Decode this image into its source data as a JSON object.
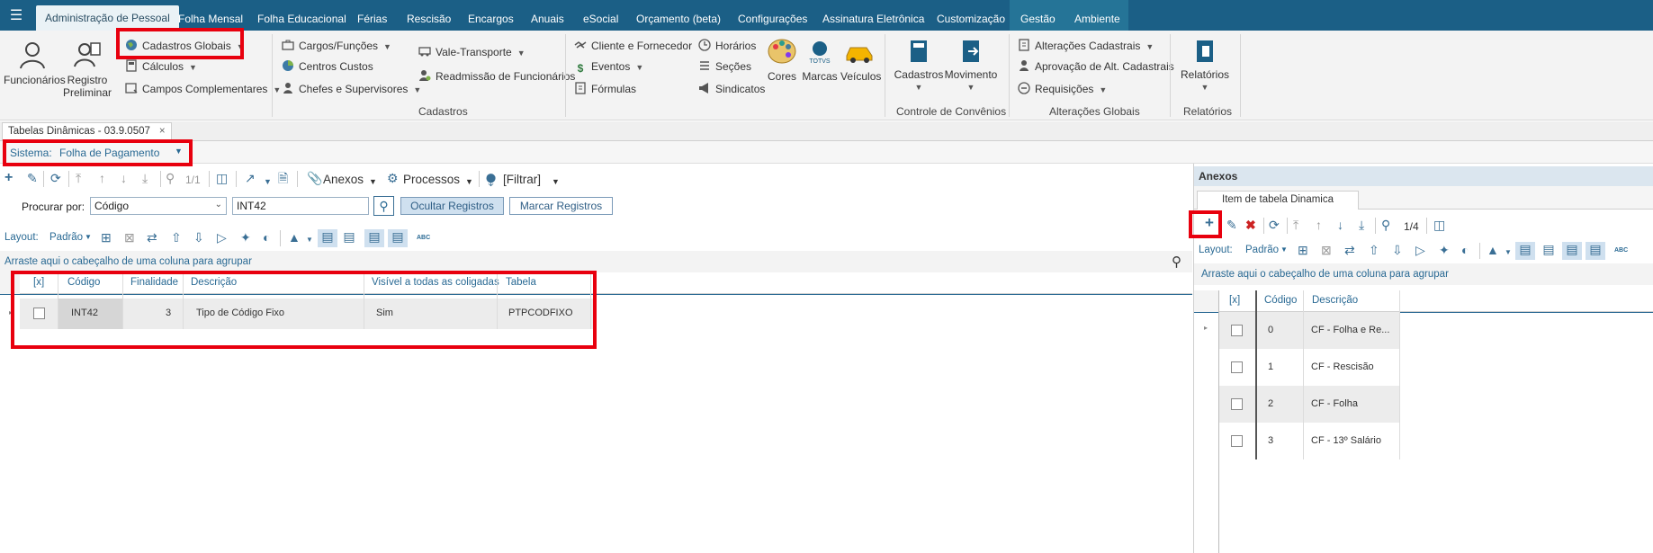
{
  "menu": {
    "tabs": [
      "Administração de Pessoal",
      "Folha Mensal",
      "Folha Educacional",
      "Férias",
      "Rescisão",
      "Encargos",
      "Anuais",
      "eSocial",
      "Orçamento (beta)",
      "Configurações",
      "Assinatura Eletrônica",
      "Customização",
      "Gestão",
      "Ambiente"
    ]
  },
  "ribbon": {
    "funcionarios": "Funcionários",
    "registro_preliminar_1": "Registro",
    "registro_preliminar_2": "Preliminar",
    "cadastros_globais": "Cadastros Globais",
    "calculos": "Cálculos",
    "campos_complementares": "Campos Complementares",
    "cargos_funcoes": "Cargos/Funções",
    "centros_custos": "Centros Custos",
    "chefes_supervisores": "Chefes e Supervisores",
    "vale_transporte": "Vale-Transporte",
    "readmissao": "Readmissão de Funcionários",
    "cliente_fornecedor": "Cliente e Fornecedor",
    "eventos": "Eventos",
    "formulas": "Fórmulas",
    "horarios": "Horários",
    "secoes": "Seções",
    "sindicatos": "Sindicatos",
    "cores": "Cores",
    "marcas": "Marcas",
    "veiculos": "Veículos",
    "group_cadastros": "Cadastros",
    "cadastros_btn": "Cadastros",
    "movimento_btn": "Movimento",
    "group_convenios": "Controle de Convênios",
    "alteracoes_cadastrais": "Alterações Cadastrais",
    "aprovacao_alt": "Aprovação de Alt. Cadastrais",
    "requisicoes": "Requisições",
    "group_alteracoes": "Alterações Globais",
    "relatorios_btn": "Relatórios",
    "group_relatorios": "Relatórios",
    "marcas_logo_text": "TOTVS"
  },
  "doc_tab": {
    "label": "Tabelas Dinâmicas - 03.9.0507",
    "close": "×"
  },
  "sistema": {
    "label": "Sistema:",
    "value": "Folha de Pagamento"
  },
  "left_toolbar": {
    "page": "1/1",
    "anexos": "Anexos",
    "processos": "Processos",
    "filtrar": "[Filtrar]"
  },
  "search": {
    "label": "Procurar por:",
    "field_value": "Código",
    "query": "INT42",
    "ocultar": "Ocultar Registros",
    "marcar": "Marcar Registros"
  },
  "layout": {
    "label": "Layout:",
    "value": "Padrão",
    "abc": "ABC"
  },
  "group_hint": "Arraste aqui o cabeçalho de uma coluna para agrupar",
  "main_grid": {
    "columns": [
      "[x]",
      "Código",
      "Finalidade",
      "Descrição",
      "Visível a todas as coligadas",
      "Tabela"
    ],
    "rows": [
      {
        "codigo": "INT42",
        "finalidade": "3",
        "descricao": "Tipo de Código Fixo",
        "visivel": "Sim",
        "tabela": "PTPCODFIXO"
      }
    ]
  },
  "anexos": {
    "title": "Anexos",
    "tab": "Item de tabela Dinamica",
    "page": "1/4",
    "layout_label": "Layout:",
    "layout_value": "Padrão",
    "group_hint": "Arraste aqui o cabeçalho de uma coluna para agrupar",
    "columns": [
      "[x]",
      "Código",
      "Descrição"
    ],
    "rows": [
      {
        "codigo": "0",
        "descricao": "CF - Folha e Re..."
      },
      {
        "codigo": "1",
        "descricao": "CF - Rescisão"
      },
      {
        "codigo": "2",
        "descricao": "CF - Folha"
      },
      {
        "codigo": "3",
        "descricao": "CF - 13º Salário"
      }
    ]
  },
  "colors": {
    "menubar": "#1b5f86",
    "highlight": "#e8000e",
    "accent": "#2a6a94"
  }
}
